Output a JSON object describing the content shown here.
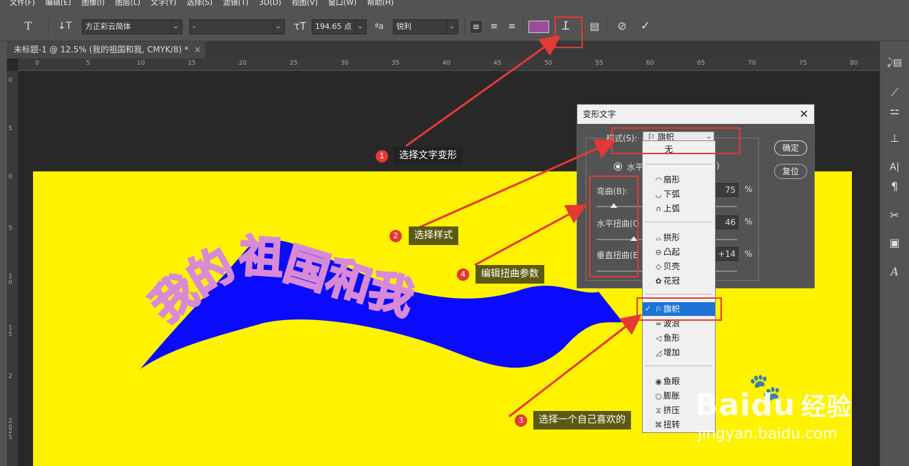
{
  "menubar": [
    "文件(F)",
    "编辑(E)",
    "图像(I)",
    "图层(L)",
    "文字(Y)",
    "选择(S)",
    "滤镜(T)",
    "3D(D)",
    "视图(V)",
    "窗口(W)",
    "帮助(H)"
  ],
  "options": {
    "font_family": "方正彩云简体",
    "font_style": "-",
    "font_size": "194.65 点",
    "aa_label": "ªa",
    "antialias": "锐利",
    "text_color": "#9b4c9b"
  },
  "document_tab": "未标题-1 @ 12.5% (我的祖国和我, CMYK/8) *",
  "ruler": {
    "h": [
      "0",
      "5",
      "10",
      "15",
      "20",
      "25",
      "30",
      "35",
      "40",
      "45",
      "50",
      "55",
      "60",
      "65",
      "70",
      "75",
      "80"
    ],
    "v": [
      "0",
      "5",
      "0",
      "5",
      "1 0",
      "1 5",
      "2",
      "2 0",
      "2 5"
    ]
  },
  "canvas_text": "我的祖国和我",
  "dialog": {
    "title": "变形文字",
    "style_label": "样式(S):",
    "style_value": "旗帜",
    "orientation_label": "水平",
    "orientation_tail": ")",
    "bend_label": "弯曲(B):",
    "bend_value": "75",
    "hdist_label": "水平扭曲(O",
    "hdist_value": "46",
    "vdist_label": "垂直扭曲(E",
    "vdist_value": "+14",
    "percent": "%",
    "ok": "确定",
    "reset": "复位"
  },
  "dropdown": {
    "none": "无",
    "group1": [
      {
        "icon": "fan-icon",
        "label": "扇形"
      },
      {
        "icon": "arc-lower-icon",
        "label": "下弧"
      },
      {
        "icon": "arc-upper-icon",
        "label": "上弧"
      }
    ],
    "group2": [
      {
        "icon": "arch-icon",
        "label": "拱形"
      },
      {
        "icon": "bulge-icon",
        "label": "凸起"
      },
      {
        "icon": "shell-icon",
        "label": "贝壳"
      },
      {
        "icon": "flower-icon",
        "label": "花冠"
      }
    ],
    "group3": [
      {
        "icon": "flag-icon",
        "label": "旗帜",
        "selected": true
      },
      {
        "icon": "wave-icon",
        "label": "波浪"
      },
      {
        "icon": "fish-icon",
        "label": "鱼形"
      },
      {
        "icon": "rise-icon",
        "label": "增加"
      }
    ],
    "group4": [
      {
        "icon": "fisheye-icon",
        "label": "鱼眼"
      },
      {
        "icon": "inflate-icon",
        "label": "膨胀"
      },
      {
        "icon": "squeeze-icon",
        "label": "挤压"
      },
      {
        "icon": "twist-icon",
        "label": "扭转"
      }
    ]
  },
  "callouts": [
    {
      "num": "1",
      "text": "选择文字变形"
    },
    {
      "num": "2",
      "text": "选择样式"
    },
    {
      "num": "4",
      "text": "编辑扭曲参数"
    },
    {
      "num": "3",
      "text": "选择一个自己喜欢的"
    }
  ],
  "watermark": {
    "brand": "Bai",
    "brand2": "du",
    "cn": "经验",
    "url": "jingyan.baidu.com"
  },
  "colors": {
    "canvas": "#fff300",
    "banner": "#0a0aff",
    "letter": "#d98ad6",
    "annotation": "#e53935"
  }
}
